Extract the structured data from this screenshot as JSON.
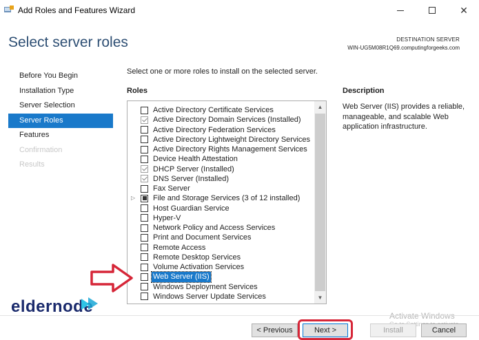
{
  "window": {
    "title": "Add Roles and Features Wizard",
    "minimize_glyph": "—",
    "close_glyph": "✕"
  },
  "page": {
    "title": "Select server roles",
    "destination_label": "DESTINATION SERVER",
    "destination_server": "WIN-UG5M08R1Q69.computingforgeeks.com"
  },
  "nav": {
    "items": [
      {
        "label": "Before You Begin",
        "state": "normal"
      },
      {
        "label": "Installation Type",
        "state": "normal"
      },
      {
        "label": "Server Selection",
        "state": "normal"
      },
      {
        "label": "Server Roles",
        "state": "active"
      },
      {
        "label": "Features",
        "state": "normal"
      },
      {
        "label": "Confirmation",
        "state": "disabled"
      },
      {
        "label": "Results",
        "state": "disabled"
      }
    ]
  },
  "content": {
    "instruction": "Select one or more roles to install on the selected server.",
    "roles_heading": "Roles",
    "description_heading": "Description",
    "description_text": "Web Server (IIS) provides a reliable, manageable, and scalable Web application infrastructure."
  },
  "roles": [
    {
      "label": "Active Directory Certificate Services",
      "state": "unchecked"
    },
    {
      "label": "Active Directory Domain Services (Installed)",
      "state": "checked"
    },
    {
      "label": "Active Directory Federation Services",
      "state": "unchecked"
    },
    {
      "label": "Active Directory Lightweight Directory Services",
      "state": "unchecked"
    },
    {
      "label": "Active Directory Rights Management Services",
      "state": "unchecked"
    },
    {
      "label": "Device Health Attestation",
      "state": "unchecked"
    },
    {
      "label": "DHCP Server (Installed)",
      "state": "checked"
    },
    {
      "label": "DNS Server (Installed)",
      "state": "checked"
    },
    {
      "label": "Fax Server",
      "state": "unchecked"
    },
    {
      "label": "File and Storage Services (3 of 12 installed)",
      "state": "partial",
      "expandable": true
    },
    {
      "label": "Host Guardian Service",
      "state": "unchecked"
    },
    {
      "label": "Hyper-V",
      "state": "unchecked"
    },
    {
      "label": "Network Policy and Access Services",
      "state": "unchecked"
    },
    {
      "label": "Print and Document Services",
      "state": "unchecked"
    },
    {
      "label": "Remote Access",
      "state": "unchecked"
    },
    {
      "label": "Remote Desktop Services",
      "state": "unchecked"
    },
    {
      "label": "Volume Activation Services",
      "state": "unchecked"
    },
    {
      "label": "Web Server (IIS)",
      "state": "unchecked",
      "selected": true
    },
    {
      "label": "Windows Deployment Services",
      "state": "unchecked"
    },
    {
      "label": "Windows Server Update Services",
      "state": "unchecked"
    }
  ],
  "buttons": {
    "previous": "< Previous",
    "next": "Next >",
    "install": "Install",
    "cancel": "Cancel"
  },
  "watermark": {
    "line1": "Activate Windows",
    "line2": "Go to Settings to activate Windows."
  },
  "logo": {
    "text": "eldernode"
  },
  "colors": {
    "accent": "#1979ca",
    "title_blue": "#2d4e73",
    "highlight_red": "#d62638"
  }
}
